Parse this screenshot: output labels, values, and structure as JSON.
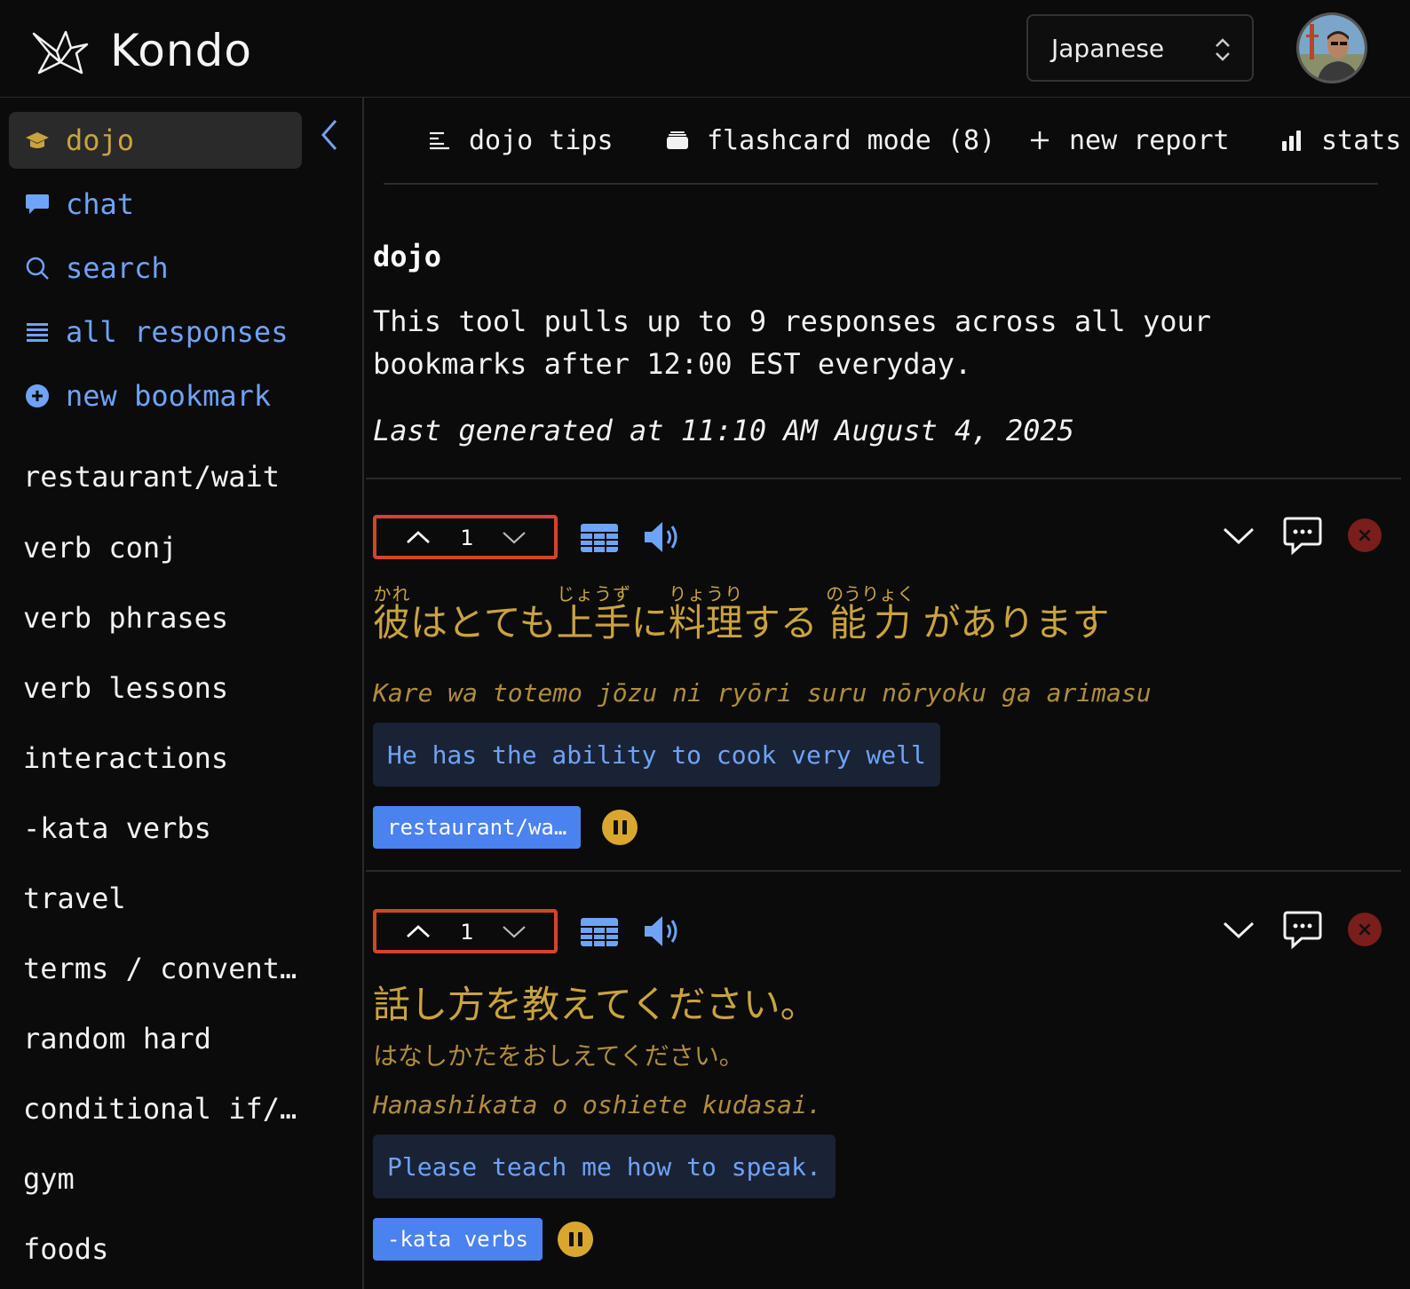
{
  "app": {
    "title": "Kondo",
    "language": "Japanese"
  },
  "colors": {
    "accent_gold": "#c9a33e",
    "accent_blue": "#6ea3f7",
    "stepper_border": "#d2452b",
    "tag_bg": "#4a82f0",
    "close_bg": "#7a1d1d"
  },
  "sidebar": {
    "nav": [
      {
        "label": "dojo",
        "icon": "graduation-cap-icon",
        "active": true
      },
      {
        "label": "chat",
        "icon": "chat-bubble-icon"
      },
      {
        "label": "search",
        "icon": "search-icon"
      },
      {
        "label": "all responses",
        "icon": "list-icon"
      },
      {
        "label": "new bookmark",
        "icon": "plus-circle-icon"
      }
    ],
    "bookmarks": [
      "restaurant/wait",
      "verb conj",
      "verb phrases",
      "verb lessons",
      "interactions",
      "-kata verbs",
      "travel",
      "terms / convent…",
      "random hard",
      "conditional if/…",
      "gym",
      "foods"
    ]
  },
  "toolbar": {
    "tips": "dojo tips",
    "flashcard": "flashcard mode (8)",
    "new_report": "new report",
    "stats": "stats"
  },
  "intro": {
    "title": "dojo",
    "description": "This tool pulls up to 9 responses across all your bookmarks after 12:00 EST everyday.",
    "generated": "Last generated at 11:10 AM August 4, 2025"
  },
  "cards": [
    {
      "count": "1",
      "japanese": {
        "kare": "彼",
        "kare_rt": "かれ",
        "s1": "はとても",
        "jozu": "上手",
        "jozu_rt": "じょうず",
        "s2": "に",
        "ryori": "料理",
        "ryori_rt": "りょうり",
        "s3": "する",
        "noryoku": "能力",
        "noryoku_rt": "のうりょく",
        "s4": "があります"
      },
      "romaji": "Kare wa totemo jōzu ni ryōri suru nōryoku ga arimasu",
      "translation": "He has the ability to cook very well",
      "tag": "restaurant/wa…"
    },
    {
      "count": "1",
      "japanese": "話し方を教えてください。",
      "kana": "はなしかたをおしえてください。",
      "romaji": "Hanashikata o oshiete kudasai.",
      "translation": "Please teach me how to speak.",
      "tag": "-kata verbs"
    }
  ]
}
